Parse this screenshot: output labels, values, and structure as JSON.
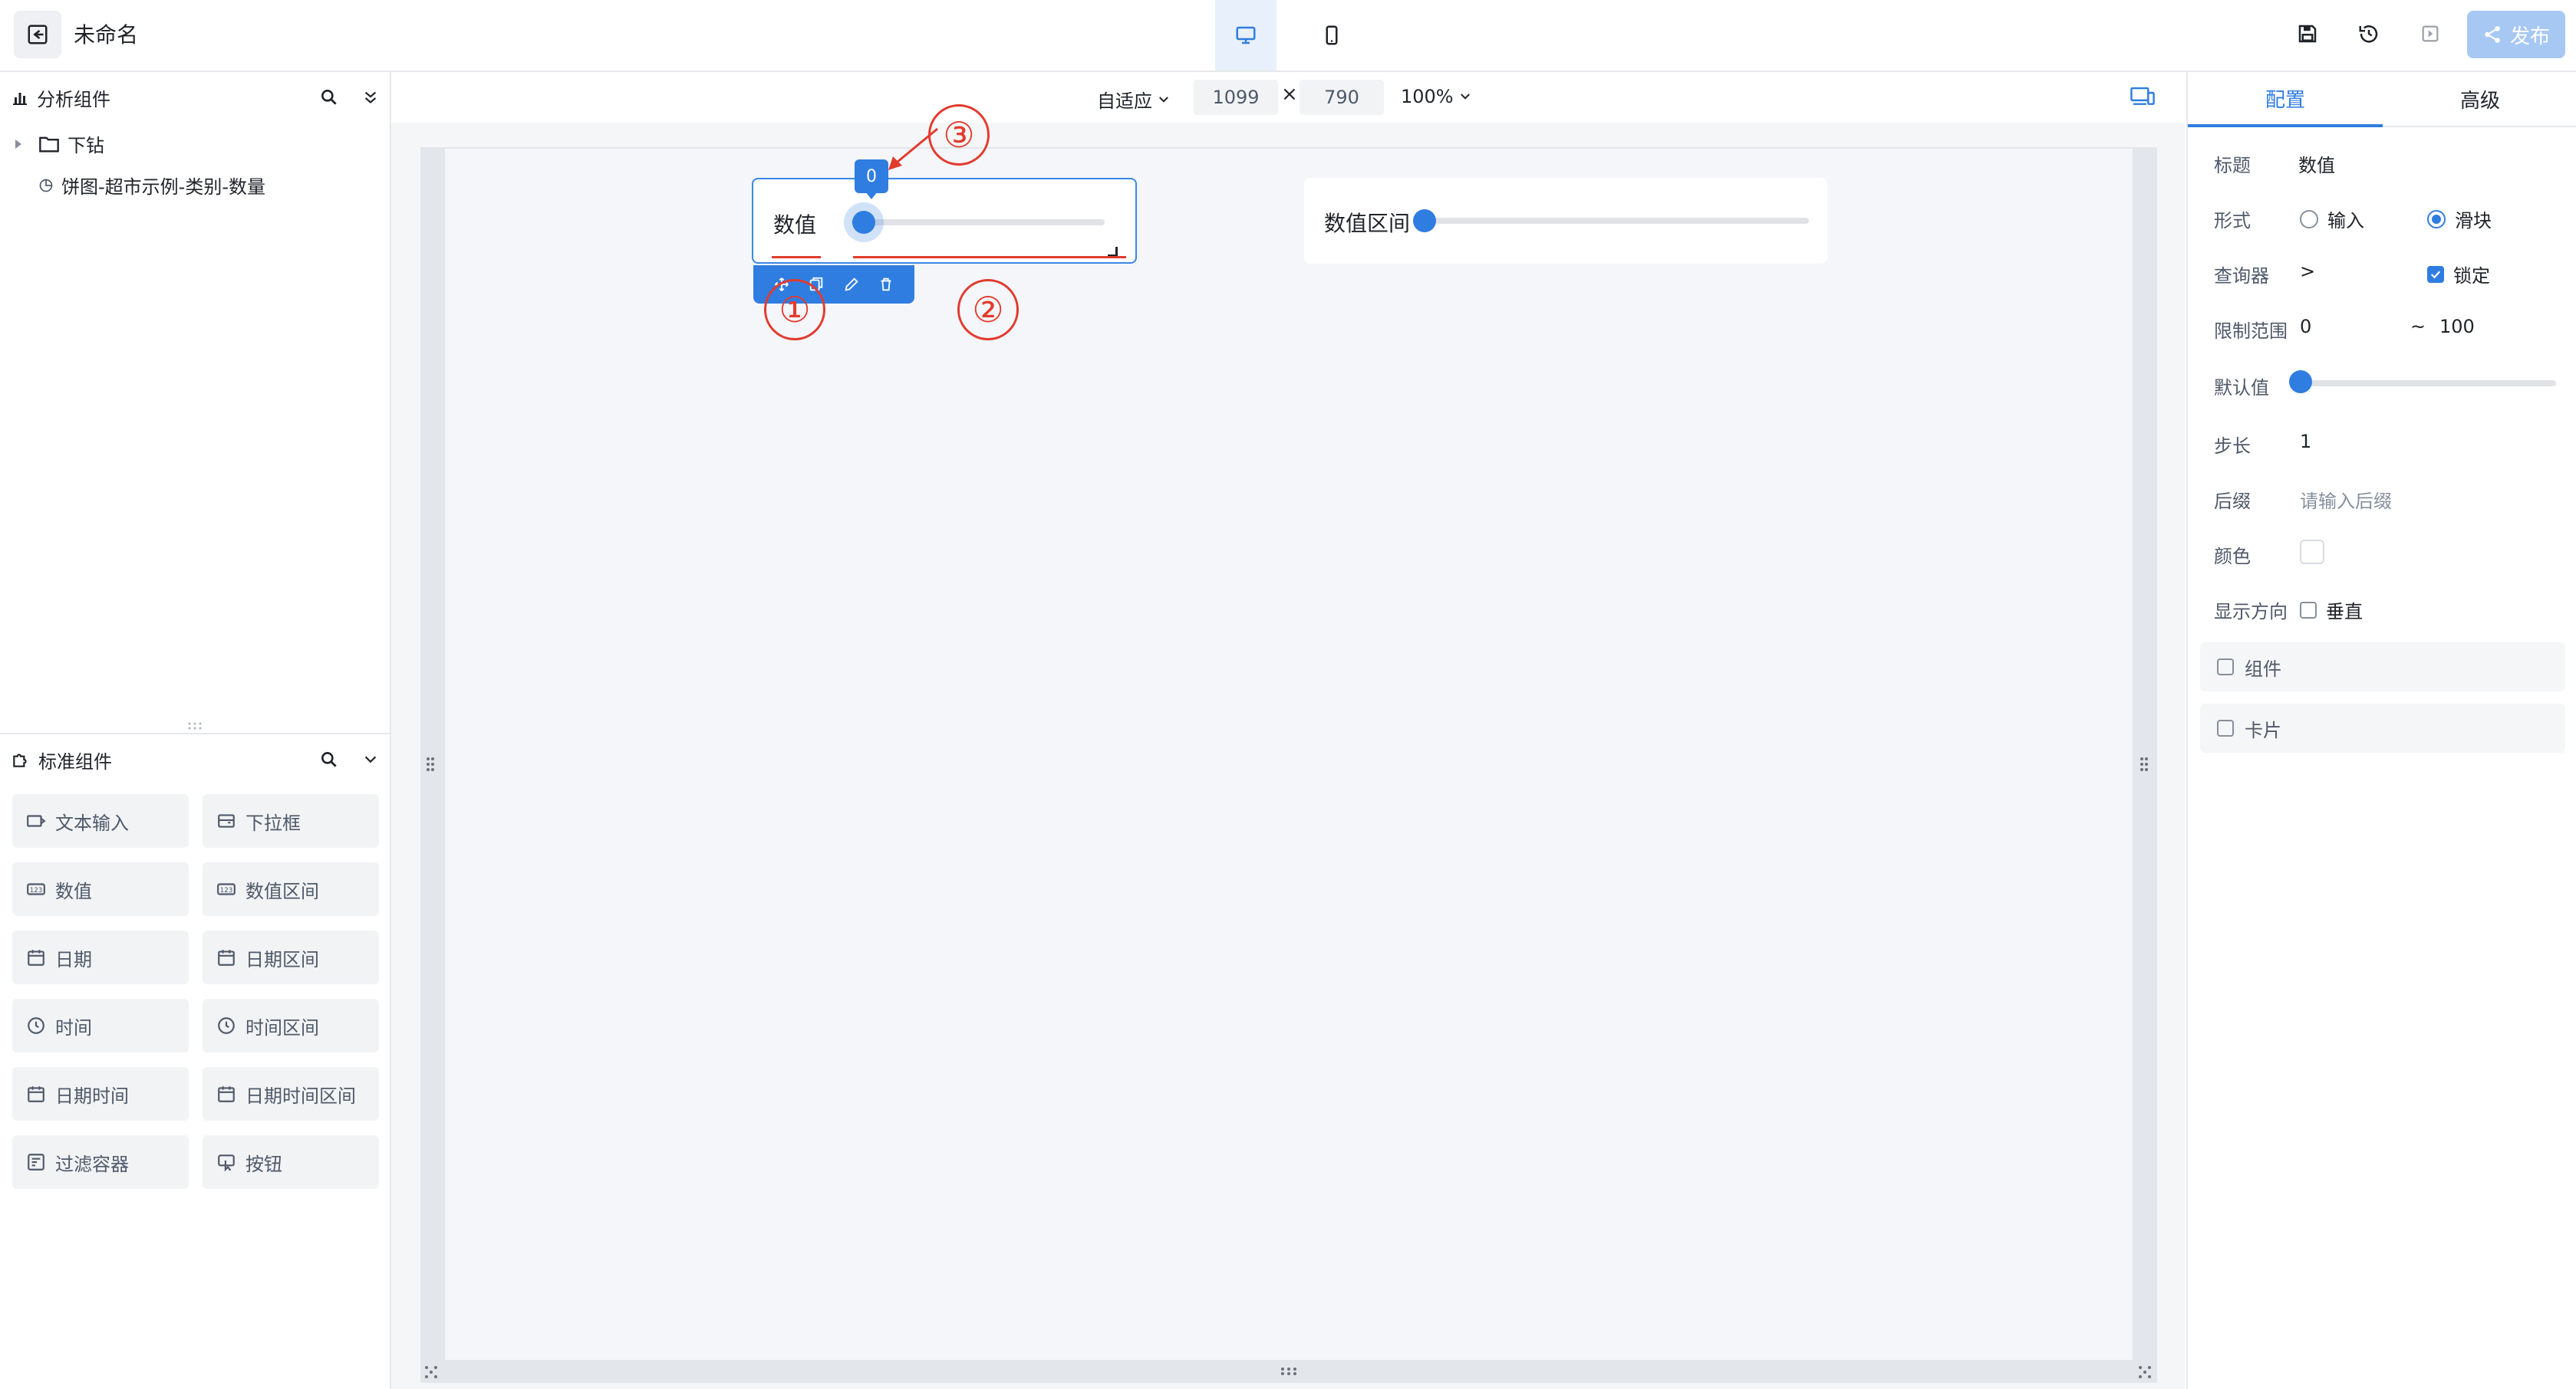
{
  "header": {
    "title": "未命名",
    "publish_label": "发布"
  },
  "left": {
    "analysis_title": "分析组件",
    "tree": [
      {
        "label": "下钻"
      },
      {
        "label": "饼图-超市示例-类别-数量"
      }
    ],
    "standard_title": "标准组件",
    "components": [
      {
        "label": "文本输入",
        "icon": "text-input-icon"
      },
      {
        "label": "下拉框",
        "icon": "dropdown-icon"
      },
      {
        "label": "数值",
        "icon": "number-icon"
      },
      {
        "label": "数值区间",
        "icon": "number-range-icon"
      },
      {
        "label": "日期",
        "icon": "calendar-icon"
      },
      {
        "label": "日期区间",
        "icon": "calendar-icon"
      },
      {
        "label": "时间",
        "icon": "clock-icon"
      },
      {
        "label": "时间区间",
        "icon": "clock-icon"
      },
      {
        "label": "日期时间",
        "icon": "calendar-icon"
      },
      {
        "label": "日期时间区间",
        "icon": "calendar-icon"
      },
      {
        "label": "过滤容器",
        "icon": "filter-container-icon"
      },
      {
        "label": "按钮",
        "icon": "button-icon"
      }
    ]
  },
  "canvas": {
    "fit_mode": "自适应",
    "width": "1099",
    "times": "×",
    "height": "790",
    "zoom": "100%",
    "widget1": {
      "label": "数值",
      "tooltip": "0"
    },
    "widget2": {
      "label": "数值区间"
    },
    "annotations": [
      "①",
      "②",
      "③"
    ],
    "accent": "#2f7de1",
    "annotation_color": "#e23b2e"
  },
  "right": {
    "tabs": [
      "配置",
      "高级"
    ],
    "props": {
      "title_label": "标题",
      "title_value": "数值",
      "form_label": "形式",
      "form_opt1": "输入",
      "form_opt2": "滑块",
      "query_label": "查询器",
      "query_value": ">",
      "lock_label": "锁定",
      "range_label": "限制范围",
      "range_min": "0",
      "range_sep": "~",
      "range_max": "100",
      "default_label": "默认值",
      "step_label": "步长",
      "step_value": "1",
      "suffix_label": "后缀",
      "suffix_placeholder": "请输入后缀",
      "color_label": "颜色",
      "direction_label": "显示方向",
      "vertical_label": "垂直",
      "group_component": "组件",
      "group_card": "卡片"
    },
    "default_slider_fraction": 0
  }
}
